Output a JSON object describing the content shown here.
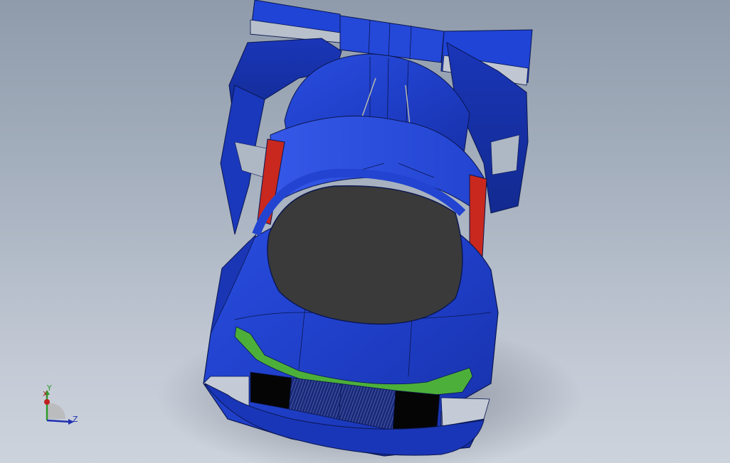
{
  "viewport": {
    "background_top": "#8f9bab",
    "background_bottom": "#cdd3dc"
  },
  "model": {
    "body_color": "#1f3fc8",
    "cockpit_color": "#3a3a3a",
    "intake_color": "#c8281e",
    "headlight_color": "#4caf3a"
  },
  "triad": {
    "y_label": "Y",
    "x_label": "X",
    "z_label": "Z",
    "y_color": "#2a9a2a",
    "x_color": "#c02020",
    "z_color": "#2030b0"
  }
}
